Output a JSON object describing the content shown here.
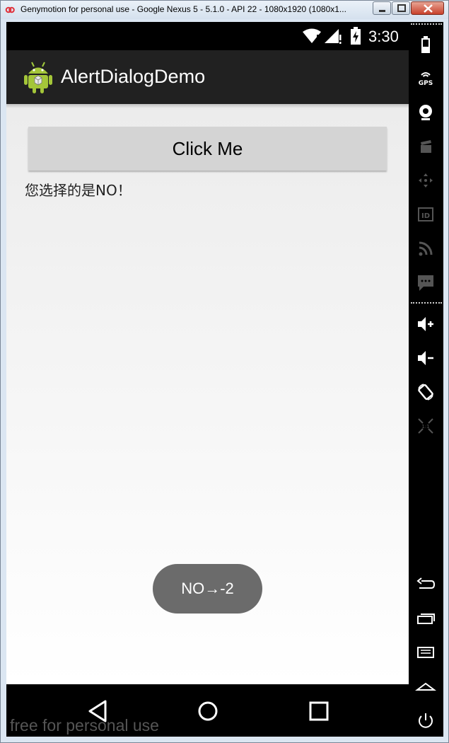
{
  "window": {
    "title": "Genymotion for personal use - Google Nexus 5 - 5.1.0 - API 22 - 1080x1920 (1080x1..."
  },
  "statusbar": {
    "time": "3:30"
  },
  "actionbar": {
    "app_title": "AlertDialogDemo"
  },
  "main": {
    "button_label": "Click Me",
    "result_text": "您选择的是NO！"
  },
  "toast": {
    "text": "NO→-2"
  },
  "watermark": "free for personal use",
  "sidebar": {
    "items": [
      "battery-icon",
      "gps-icon",
      "camera-icon",
      "video-capture-icon",
      "remote-control-icon",
      "device-id-icon",
      "network-icon",
      "sms-icon",
      "volume-up-icon",
      "volume-down-icon",
      "rotate-icon",
      "pixel-perfect-icon",
      "back-icon",
      "recent-apps-icon",
      "menu-icon",
      "home-icon",
      "power-icon"
    ]
  },
  "colors": {
    "actionbar": "#212121",
    "button": "#d4d4d4",
    "toast": "#6b6b6b"
  }
}
